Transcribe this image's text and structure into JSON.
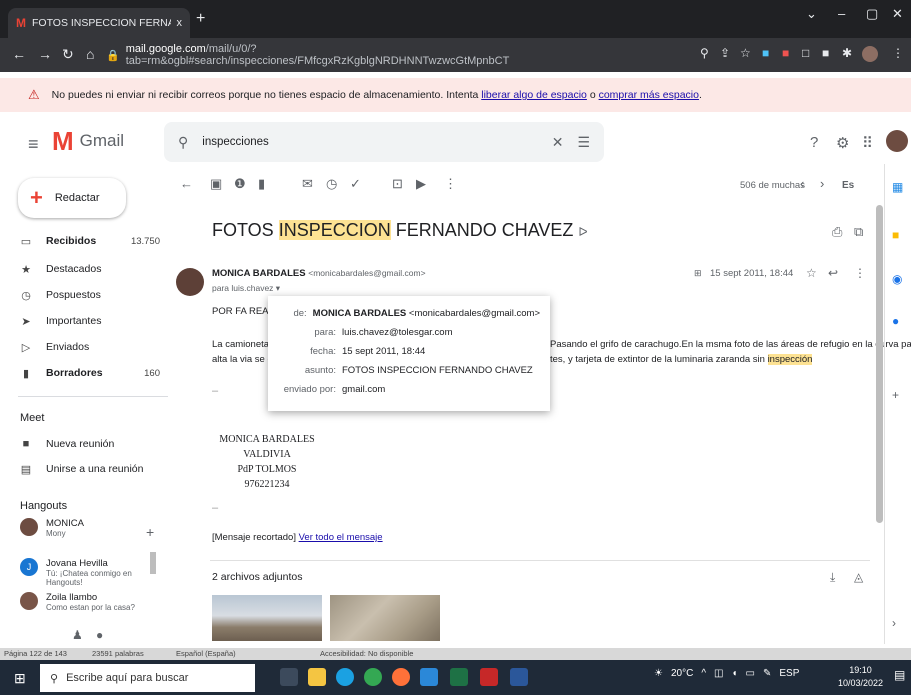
{
  "browser": {
    "tab_title": "FOTOS INSPECCION FERNANDO",
    "tab_close": "x",
    "new_tab": "+",
    "url_domain": "mail.google.com",
    "url_path": "/mail/u/0/?tab=rm&ogbl#search/inspecciones/FMfcgxRzKgblgNRDHNNTwzwcGtMpnbCT"
  },
  "banner": {
    "text": "No puedes ni enviar ni recibir correos porque no tienes espacio de almacenamiento. Intenta ",
    "link1": "liberar algo de espacio",
    "mid": " o ",
    "link2": "comprar más espacio",
    "end": "."
  },
  "gmail": {
    "logo_text": "Gmail",
    "search_value": "inspecciones",
    "compose_label": "Redactar"
  },
  "sidebar": {
    "items": [
      {
        "label": "Recibidos",
        "count": "13.750",
        "icon": "inbox-icon"
      },
      {
        "label": "Destacados",
        "count": "",
        "icon": "star-icon"
      },
      {
        "label": "Pospuestos",
        "count": "",
        "icon": "clock-icon"
      },
      {
        "label": "Importantes",
        "count": "",
        "icon": "important-icon"
      },
      {
        "label": "Enviados",
        "count": "",
        "icon": "send-icon"
      },
      {
        "label": "Borradores",
        "count": "160",
        "icon": "draft-icon"
      }
    ],
    "meet_header": "Meet",
    "meet_items": [
      {
        "label": "Nueva reunión"
      },
      {
        "label": "Unirse a una reunión"
      }
    ],
    "hangouts_header": "Hangouts",
    "hangouts_self": {
      "name": "MONICA",
      "sub": "Mony"
    },
    "contacts": [
      {
        "name": "Jovana Hevilla",
        "sub": "Tú: ¡Chatea conmigo en Hangouts!"
      },
      {
        "name": "Zoila llambo",
        "sub": "Como estan por la casa?"
      }
    ]
  },
  "toolbar": {
    "pager": "506 de muchas",
    "lang": "Es"
  },
  "message": {
    "subject_pre": "FOTOS ",
    "subject_hl": "INSPECCION",
    "subject_post": " FERNANDO CHAVEZ",
    "sender_name": "MONICA BARDALES",
    "sender_email": "<monicabardales@gmail.com>",
    "to_line": "para luis.chavez",
    "date": "15 sept 2011, 18:44",
    "greeting": "POR FA REALIZ",
    "body_left_1": "La camioneta es",
    "body_left_2": "alta la via se enc",
    "body_right_1": "Pasando el grifo de carachugo.En la msma foto de las áreas de refugio en la curva parte",
    "body_right_2": "tes, y tarjeta de extintor de la luminaria zaranda sin ",
    "body_hl": "inspección",
    "dash": "–",
    "sig_name": "MONICA BARDALES VALDIVIA",
    "sig_org": "PdP TOLMOS",
    "sig_phone": "976221234",
    "trimmed": "[Mensaje recortado]",
    "view_all": "Ver todo el mensaje",
    "attachments": "2 archivos adjuntos"
  },
  "popup": {
    "rows": [
      {
        "k": "de:",
        "v_bold": "MONICA BARDALES",
        "v": " <monicabardales@gmail.com>"
      },
      {
        "k": "para:",
        "v_bold": "",
        "v": "luis.chavez@tolesgar.com"
      },
      {
        "k": "fecha:",
        "v_bold": "",
        "v": "15 sept 2011, 18:44"
      },
      {
        "k": "asunto:",
        "v_bold": "",
        "v": "FOTOS INSPECCION FERNANDO CHAVEZ"
      },
      {
        "k": "enviado por:",
        "v_bold": "",
        "v": "gmail.com"
      }
    ]
  },
  "wordbar": {
    "page": "Página 122 de 143",
    "words": "23591 palabras",
    "lang": "Español (España)",
    "access": "Accesibilidad: No disponible"
  },
  "taskbar": {
    "search_placeholder": "Escribe aquí para buscar",
    "weather": "20°C",
    "lang": "ESP",
    "time": "19:10",
    "date": "10/03/2022"
  },
  "colors": {
    "gmail_red": "#ea4335",
    "banner_bg": "#fce8e6",
    "highlight": "#fde293",
    "link": "#1a0dab"
  }
}
